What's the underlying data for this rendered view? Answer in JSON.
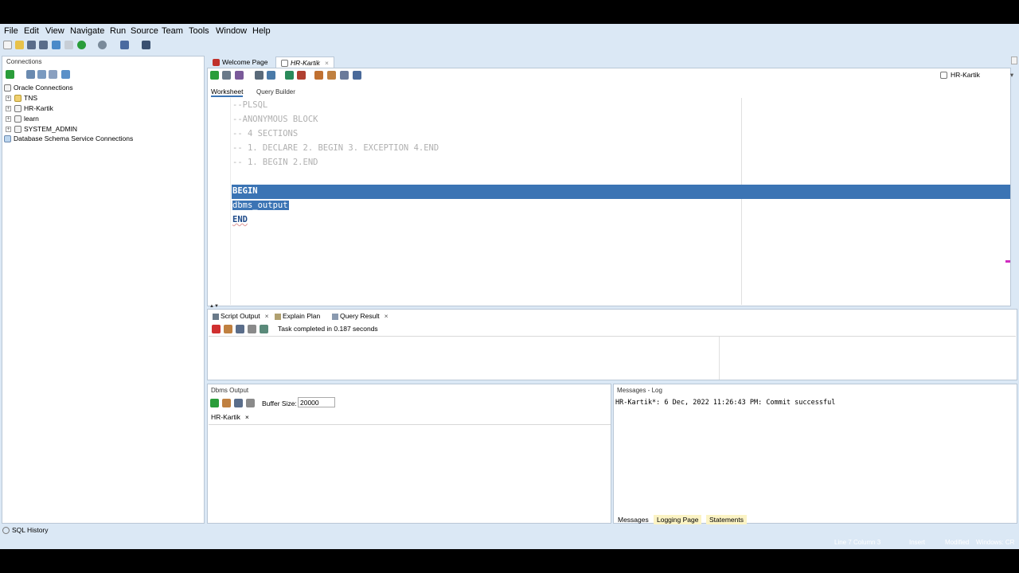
{
  "menu": [
    "File",
    "Edit",
    "View",
    "Navigate",
    "Run",
    "Source",
    "Team",
    "Tools",
    "Window",
    "Help"
  ],
  "connections": {
    "title": "Connections",
    "root": "Oracle Connections",
    "items": [
      "TNS",
      "HR-Kartik",
      "learn",
      "SYSTEM_ADMIN"
    ],
    "db_schema": "Database Schema Service Connections"
  },
  "editor_tabs": {
    "welcome": "Welcome Page",
    "active": "HR-Kartik"
  },
  "connection_selector": "HR-Kartik",
  "worksheet_tabs": {
    "worksheet": "Worksheet",
    "query_builder": "Query Builder"
  },
  "code_lines": [
    "--PLSQL",
    "--ANONYMOUS BLOCK",
    "-- 4 SECTIONS",
    "-- 1. DECLARE 2. BEGIN 3. EXCEPTION 4.END",
    "-- 1. BEGIN 2.END",
    "",
    "BEGIN",
    "dbms_output",
    "END"
  ],
  "output_tabs": {
    "script_output": "Script Output",
    "explain_plan": "Explain Plan",
    "query_result": "Query Result"
  },
  "script_status": "Task completed in 0.187 seconds",
  "dbms_output": {
    "title": "Dbms Output",
    "buffer_label": "Buffer Size:",
    "buffer_value": "20000",
    "tab": "HR-Kartik"
  },
  "messages_log": {
    "title": "Messages - Log",
    "message": "HR-Kartik*: 6 Dec, 2022 11:26:43 PM: Commit successful",
    "tabs": [
      "Messages",
      "Logging Page",
      "Statements"
    ]
  },
  "sql_history": "SQL History",
  "status": {
    "position": "Line 7 Column 3",
    "mode": "Insert",
    "modified": "Modified",
    "platform": "Windows: CR"
  }
}
